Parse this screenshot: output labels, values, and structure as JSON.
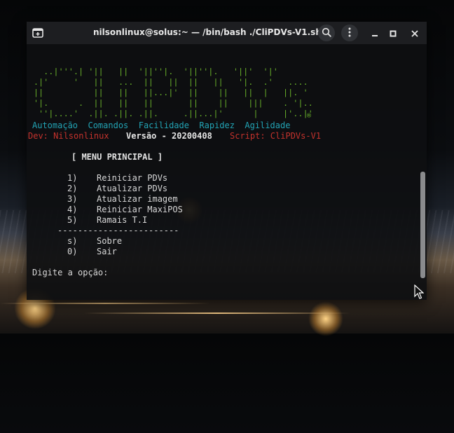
{
  "window": {
    "title": "nilsonlinux@solus:~ — /bin/bash ./CliPDVs-V1.sh"
  },
  "icons": {
    "new_tab": "new-tab-icon",
    "search": "search-icon",
    "menu": "kebab-menu-icon",
    "minimize": "minimize-icon",
    "maximize": "maximize-icon",
    "close": "close-icon"
  },
  "colors": {
    "logo_green": "#6ab32b",
    "cyan": "#22a3b4",
    "red": "#c4322c",
    "terminal_bg": "#0e0f11"
  },
  "banner": {
    "logo_lines": [
      "  ..|'''.| '||   ||  '||''|.  '||''|.   '||'  '|'",
      ".|'     '   ||   ...  ||   ||  ||   ||   '|.  .'   ....",
      "||          ||   ||   ||...|'  ||    ||   ||  |   ||. '",
      "'|.      .  ||   ||   ||       ||    ||    |||    . '|..",
      " ''|....'  .||. .||. .||.     .||...|'      |     |'..|'"
    ],
    "registered_mark": "®",
    "tagline": "Automação  Comandos  Facilidade  Rapidez  Agilidade",
    "dev": "Dev: Nilsonlinux",
    "version": "Versão - 20200408",
    "script": "Script: CliPDVs-V1"
  },
  "menu": {
    "header": "[ MENU PRINCIPAL ]",
    "items": [
      {
        "key": "1)",
        "label": "Reiniciar PDVs"
      },
      {
        "key": "2)",
        "label": "Atualizar PDVs"
      },
      {
        "key": "3)",
        "label": "Atualizar imagem"
      },
      {
        "key": "4)",
        "label": "Reiniciar MaxiPOS"
      },
      {
        "key": "5)",
        "label": "Ramais T.I"
      }
    ],
    "separator": "------------------------",
    "extra_items": [
      {
        "key": "s)",
        "label": "Sobre"
      },
      {
        "key": "0)",
        "label": "Sair"
      }
    ],
    "prompt": "Digite a opção:"
  }
}
